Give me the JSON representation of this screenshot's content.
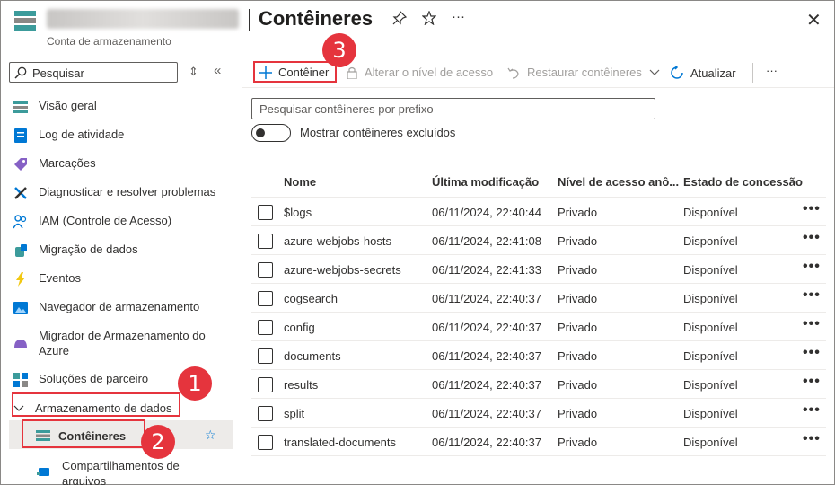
{
  "header": {
    "subtitle": "Conta de armazenamento",
    "title": "Contêineres",
    "pin_icon": "pin-icon",
    "star_icon": "star-icon",
    "more": "···",
    "close": "✕"
  },
  "sidebar": {
    "search_placeholder": "Pesquisar",
    "items": [
      {
        "label": "Visão geral",
        "icon": "overview-icon"
      },
      {
        "label": "Log de atividade",
        "icon": "activity-log-icon"
      },
      {
        "label": "Marcações",
        "icon": "tag-icon"
      },
      {
        "label": "Diagnosticar e resolver problemas",
        "icon": "wrench-icon"
      },
      {
        "label": "IAM (Controle de Acesso)",
        "icon": "people-icon"
      },
      {
        "label": "Migração de dados",
        "icon": "migration-icon"
      },
      {
        "label": "Eventos",
        "icon": "lightning-icon"
      },
      {
        "label": "Navegador de armazenamento",
        "icon": "storage-browser-icon"
      },
      {
        "label": "Migrador de Armazenamento do Azure",
        "icon": "storage-mover-icon"
      },
      {
        "label": "Soluções de parceiro",
        "icon": "partner-icon"
      }
    ],
    "group": {
      "label": "Armazenamento de dados",
      "expanded": true
    },
    "sub_items": [
      {
        "label": "Contêineres",
        "selected": true
      },
      {
        "label": "Compartilhamentos de arquivos"
      }
    ]
  },
  "toolbar": {
    "add": "Contêiner",
    "access": "Alterar o nível de acesso",
    "restore": "Restaurar contêineres",
    "refresh": "Atualizar",
    "more": "···"
  },
  "filter": {
    "placeholder": "Pesquisar contêineres por prefixo",
    "toggle_label": "Mostrar contêineres excluídos"
  },
  "table": {
    "columns": [
      "Nome",
      "Última modificação",
      "Nível de acesso anô...",
      "Estado de concessão"
    ],
    "rows": [
      [
        "$logs",
        "06/11/2024, 22:40:44",
        "Privado",
        "Disponível"
      ],
      [
        "azure-webjobs-hosts",
        "06/11/2024, 22:41:08",
        "Privado",
        "Disponível"
      ],
      [
        "azure-webjobs-secrets",
        "06/11/2024, 22:41:33",
        "Privado",
        "Disponível"
      ],
      [
        "cogsearch",
        "06/11/2024, 22:40:37",
        "Privado",
        "Disponível"
      ],
      [
        "config",
        "06/11/2024, 22:40:37",
        "Privado",
        "Disponível"
      ],
      [
        "documents",
        "06/11/2024, 22:40:37",
        "Privado",
        "Disponível"
      ],
      [
        "results",
        "06/11/2024, 22:40:37",
        "Privado",
        "Disponível"
      ],
      [
        "split",
        "06/11/2024, 22:40:37",
        "Privado",
        "Disponível"
      ],
      [
        "translated-documents",
        "06/11/2024, 22:40:37",
        "Privado",
        "Disponível"
      ]
    ],
    "row_more": "•••"
  },
  "badges": [
    "1",
    "2",
    "3"
  ],
  "colors": {
    "accent": "#0078d4",
    "callout": "#e5343d",
    "selected_bg": "#edebe9"
  }
}
